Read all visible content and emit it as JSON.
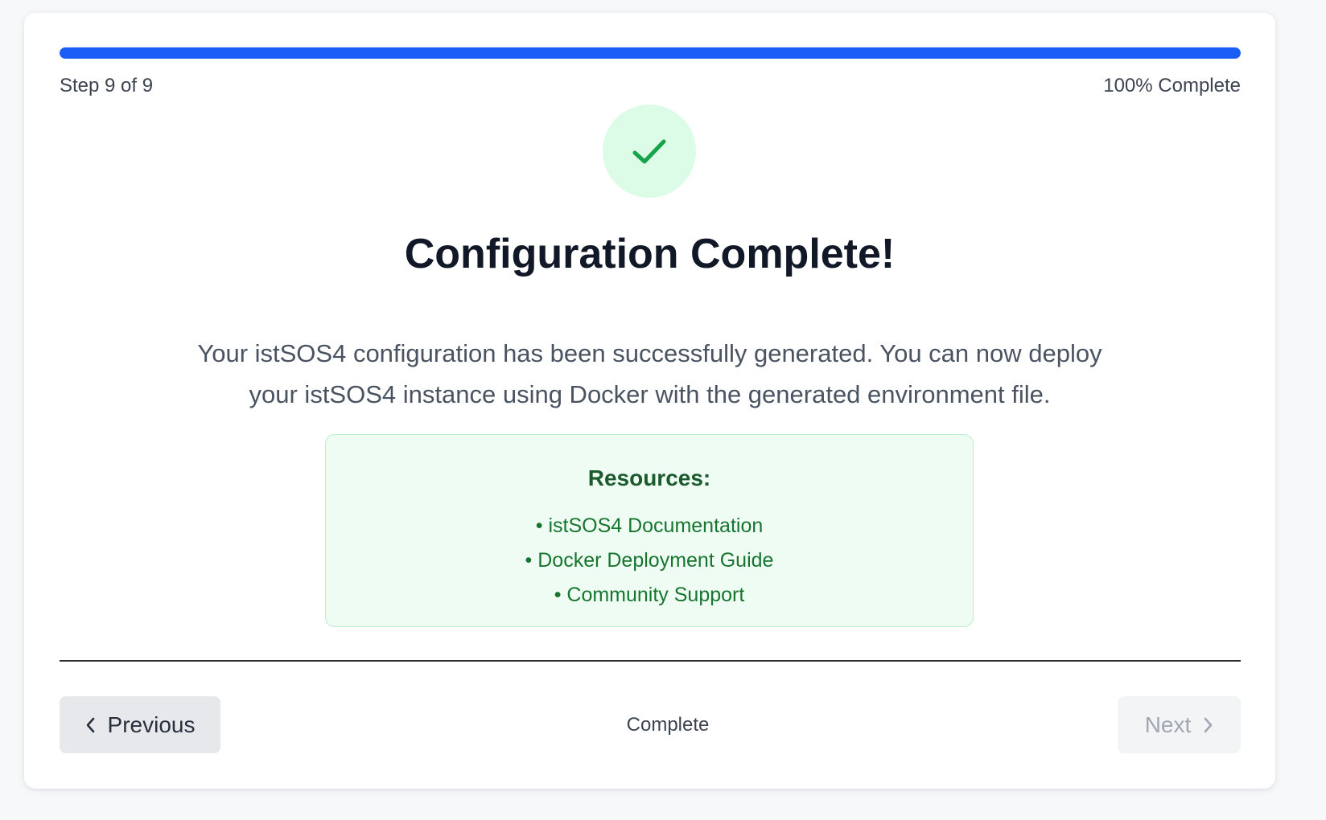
{
  "progress": {
    "step_text": "Step 9 of 9",
    "percent_text": "100% Complete",
    "fill_fraction": 1.0,
    "accent_color": "#1b5ef5"
  },
  "success": {
    "icon": "checkmark-icon",
    "title": "Configuration Complete!",
    "description": "Your istSOS4 configuration has been successfully generated. You can now deploy your istSOS4 instance using Docker with the generated environment file."
  },
  "resources": {
    "title": "Resources:",
    "items": [
      "• istSOS4 Documentation",
      "• Docker Deployment Guide",
      "• Community Support"
    ]
  },
  "footer": {
    "previous_label": "Previous",
    "status_text": "Complete",
    "next_label": "Next"
  }
}
